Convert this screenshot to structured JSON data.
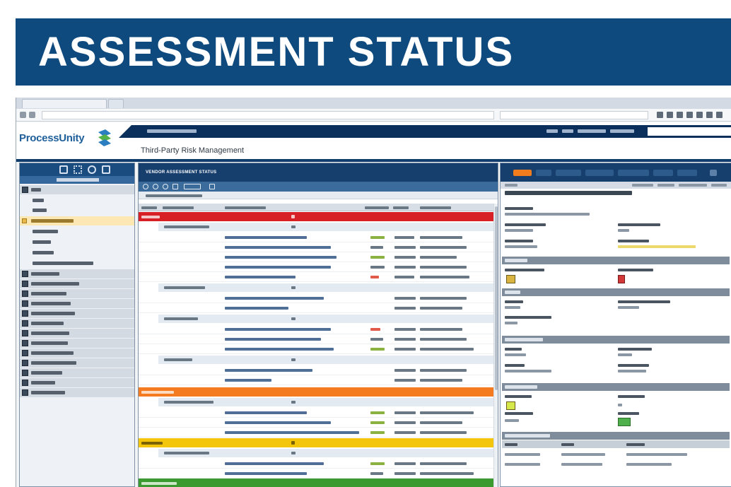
{
  "banner": {
    "title": "ASSESSMENT STATUS"
  },
  "app": {
    "brand": "ProcessUnity",
    "module_title": "Third-Party Risk Management"
  },
  "center_pane": {
    "title": "VENDOR ASSESSMENT STATUS",
    "groups": [
      {
        "status_color": "#d71f26"
      },
      {
        "status_color": "#f47b20"
      },
      {
        "status_color": "#f3c60b"
      },
      {
        "status_color": "#3b9a2f"
      }
    ]
  },
  "right_pane": {
    "tabs": [
      {
        "active": true
      },
      {},
      {},
      {},
      {},
      {},
      {}
    ],
    "score_chip_colors": [
      "#d9b441",
      "#d23838",
      "#d6e84a",
      "#4db04a"
    ]
  },
  "colors": {
    "banner": "#0e4a7e",
    "nav_dark": "#0b2f5c",
    "pane_header": "#163f6e",
    "active_tab": "#f07c1e",
    "active_nav_item": "#fde7b3"
  }
}
